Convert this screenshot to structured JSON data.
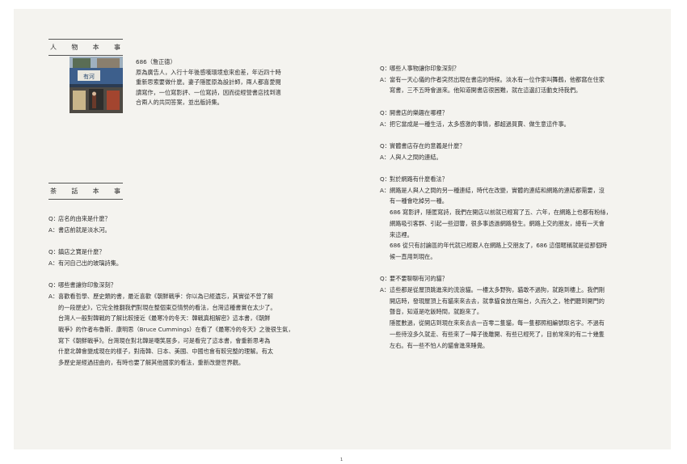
{
  "profile_title": [
    "人",
    "物",
    "本",
    "事"
  ],
  "tea_title": [
    "茶",
    "話",
    "本",
    "事"
  ],
  "bio": {
    "lines": [
      "686（詹正德）",
      "原為廣告人，入行十年後感嘆環境愈來愈差，年近四十時",
      "重新思索要做什麼。妻子隱匿原為設計師，兩人都喜愛閱",
      "讀寫作，一位寫影評、一位寫詩，因而從經營書店找到適",
      "合兩人的共同答案，並出版詩集。"
    ]
  },
  "photo": {
    "sign_text": "有河"
  },
  "left_qa": [
    {
      "q_label": "Q：",
      "q": "店名的由來是什麼？",
      "a_label": "A：",
      "a": "書店前就是淡水河。",
      "a_cont": []
    },
    {
      "q_label": "Q：",
      "q": "鎮店之寶是什麼？",
      "a_label": "A：",
      "a": "有河自己出的玻璃詩集。",
      "a_cont": []
    },
    {
      "q_label": "Q：",
      "q": "哪些書讓你印象深刻？",
      "a_label": "A：",
      "a": "喜歡看哲學、歷史類的書，最近喜歡《朝鮮戰爭：你以為已經遺忘，其實從不曾了解",
      "a_cont": [
        "的一段歷史》，它完全推翻我們對現在整個東亞情勢的看法，台灣這種書實在太少了。",
        "台灣人一般對韓戰的了解比較接近《最寒冷的冬天：韓戰真相解密》這本書，《朝鮮",
        "戰爭》的作者布魯斯．康明思（Bruce Cummings）在看了《最寒冷的冬天》之後很生氣，",
        "寫下《朝鮮戰爭》。台灣現在對北韓是嘲笑居多，可是看完了這本書，會重新思考為",
        "什麼北韓會變成現在的樣子，對南韓、日本、美國、中國也會有較完整的理解。有太",
        "多歷史是經過扭曲的，有時也要了解其他國家的看法，重新改變世界觀。"
      ]
    }
  ],
  "right_qa": [
    {
      "q_label": "Q：",
      "q": "哪些人事物讓你印象深刻？",
      "a_label": "A：",
      "a": "當有一天心儀的作者突然出現在書店的時候。淡水有一位作家叫舞鶴，他都窩在住家",
      "a_cont": [
        "寫書，三不五時會過來。他知道開書店很困難，就在這邊訂活動支持我們。"
      ]
    },
    {
      "q_label": "Q：",
      "q": "開書店的樂趣在哪裡？",
      "a_label": "A：",
      "a": "把它當成是一種生活，太多感激的事情，都超過買賣、做生意這件事。",
      "a_cont": []
    },
    {
      "q_label": "Q：",
      "q": "實體書店存在的意義是什麼？",
      "a_label": "A：",
      "a": "人與人之間的連結。",
      "a_cont": []
    },
    {
      "q_label": "Q：",
      "q": "對於網路有什麼看法？",
      "a_label": "A：",
      "a": "網路是人與人之間的另一種連結，時代在改變，實體的連結和網路的連結都需要，沒",
      "a_cont": [
        "有一種會吃掉另一種。",
        "686 寫影評，隱匿寫詩，我們在開店以前就已經寫了五、六年，在網路上也都有粉絲，",
        "網路吸引客群、引起一些迴響，很多事透過網路發生。網路上交的朋友，總有一天會",
        "來這裡。",
        "686 從只有討論區的年代就已經跟人在網路上交朋友了，686 這個暱稱就是從那個時",
        "候一直用到現在。"
      ]
    },
    {
      "q_label": "Q：",
      "q": "要不要聊聊有河的貓？",
      "a_label": "A：",
      "a": "這些都是從屋頂跳進來的流浪貓。一樓太多野狗，貓敢不過狗，就跑到樓上。我們剛",
      "a_cont": [
        "開店時，發現屋頂上有貓來來去去，就拿貓食放在陽台，久而久之，牠們聽到開門的",
        "聲音，知道是吃飯時間，就跑來了。",
        "隱匿數過，從開店到現在來來去去一百零二隻貓，每一隻都照相編號取名字。不過有",
        "一些待沒多久就走、有些來了一陣子後離開、有些已經死了，目前常來的有二十幾隻",
        "左右。有一些不怕人的貓會進來睡覺。"
      ]
    }
  ],
  "folio": "1"
}
